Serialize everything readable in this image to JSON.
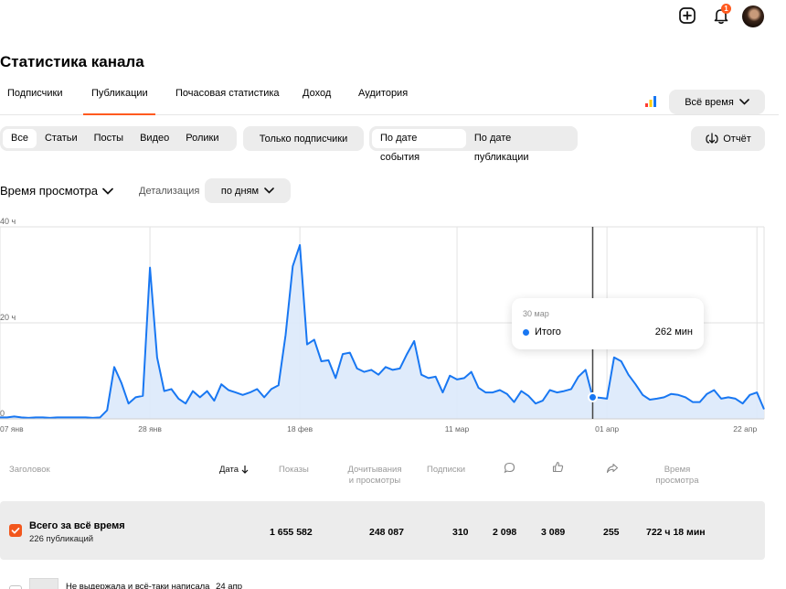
{
  "header": {
    "notification_count": "1",
    "icons": [
      "plus-icon",
      "bell-icon",
      "avatar"
    ]
  },
  "page_title": "Статистика канала",
  "tabs": [
    {
      "label": "Подписчики"
    },
    {
      "label": "Публикации",
      "active": true
    },
    {
      "label": "Почасовая статистика"
    },
    {
      "label": "Доход"
    },
    {
      "label": "Аудитория"
    }
  ],
  "period_label": "Всё время",
  "content_filter": {
    "items": [
      "Все",
      "Статьи",
      "Посты",
      "Видео",
      "Ролики"
    ],
    "selected": "Все"
  },
  "subscribers_only_label": "Только подписчики",
  "date_filter": {
    "items": [
      "По дате события",
      "По дате публикации"
    ],
    "selected": "По дате события"
  },
  "report_label": "Отчёт",
  "metric_label": "Время просмотра",
  "detail_label": "Детализация",
  "detail_value": "по дням",
  "chart_data": {
    "type": "area",
    "y_ticks": [
      "40 ч",
      "20 ч",
      "0"
    ],
    "x_ticks": [
      "07 янв",
      "28 янв",
      "18 фев",
      "11 мар",
      "01 апр",
      "22 апр"
    ],
    "ylim": [
      0,
      40
    ],
    "unit": "ч",
    "start_date": "2024-01-07",
    "values": [
      0.3,
      0.3,
      0.5,
      0.3,
      0.2,
      0.3,
      0.3,
      0.2,
      0.3,
      0.3,
      0.3,
      0.3,
      0.3,
      0.2,
      0.3,
      1.8,
      10.8,
      7.5,
      3.2,
      4.5,
      4.8,
      31.5,
      12.8,
      5.8,
      6.2,
      4.2,
      3.2,
      5.8,
      4.5,
      5.8,
      3.8,
      7.2,
      6,
      5.5,
      5,
      5.5,
      6.2,
      4.5,
      6.2,
      7,
      17.5,
      31.8,
      36.2,
      15.5,
      16.5,
      12,
      12.2,
      8.5,
      13.5,
      13.8,
      10.5,
      9.8,
      10.2,
      9.2,
      10.8,
      10.2,
      10.5,
      13.5,
      16.2,
      9.2,
      8.5,
      8.8,
      5.5,
      9,
      8.2,
      8.5,
      9.8,
      6.5,
      5.5,
      5.5,
      6,
      5.2,
      3.5,
      5.8,
      4.8,
      3.2,
      3.8,
      6,
      5.5,
      5.8,
      6.2,
      8.8,
      10.2,
      4.5,
      4.4,
      4.2,
      12.8,
      12,
      9.2,
      7.2,
      5,
      4,
      4.2,
      4.5,
      5.2,
      5,
      4.5,
      3.5,
      3.5,
      5.2,
      6,
      4.2,
      4.5,
      4.2,
      3.2,
      5,
      5.5,
      2
    ],
    "marker_date": "30 мар",
    "tooltip": {
      "date": "30 мар",
      "series": "Итого",
      "value": "262 мин"
    }
  },
  "table": {
    "headers": {
      "title": "Заголовок",
      "date": "Дата",
      "impressions": "Показы",
      "reads_1": "Дочитывания",
      "reads_2": "и просмотры",
      "subscriptions": "Подписки",
      "watch_1": "Время",
      "watch_2": "просмотра"
    },
    "total": {
      "title": "Всего за всё время",
      "subtitle": "226 публикаций",
      "impressions": "1 655 582",
      "reads": "248 087",
      "subscriptions": "310",
      "comments": "2 098",
      "likes": "3 089",
      "shares": "255",
      "watch_time": "722 ч 18 мин"
    },
    "first_row": {
      "title": "Не выдержала и всё-таки написала",
      "date": "24 апр"
    }
  },
  "colors": {
    "accent": "#ff5a1f",
    "chart_line": "#1877f2",
    "chart_fill": "#dbe9fb",
    "chip_bg": "#ececec"
  }
}
